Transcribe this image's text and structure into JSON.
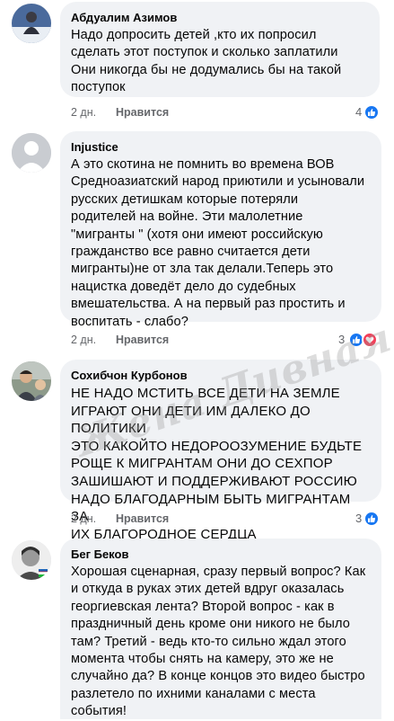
{
  "comments": [
    {
      "author": "Абдуалим Азимов",
      "text": "Надо допросить детей ,кто их попросил\nсделать этот поступок и сколько заплатили\nОни никогда бы не додумались бы на такой\nпоступок",
      "time": "2 дн.",
      "like_label": "Нравится",
      "reaction_count": "4",
      "reactions": [
        "like"
      ]
    },
    {
      "author": "Injustice",
      "text": "А это скотина не помнить во времена ВОВ\nСредноазиатский народ приютили и усыновали\nрусских детишкам   которые потеряли\nродителей на войне. Эти малолетние\n\"мигранты \" (хотя они имеют российскую\nгражданство  все равно считается дети\nмигранты)не от зла  так делали.Теперь это\nнацистка доведёт дело до судебных\nвмешательства. А на первый раз простить и\nвоспитать - слабо?",
      "time": "2 дн.",
      "like_label": "Нравится",
      "reaction_count": "3",
      "reactions": [
        "like",
        "love"
      ]
    },
    {
      "author": "Сохибчон Курбонов",
      "text": "НЕ НАДО МСТИТЬ ВСЕ ДЕТИ  НА ЗЕМЛЕ\nИГРАЮТ ОНИ ДЕТИ ИМ ДАЛЕКО ДО ПОЛИТИКИ\nЭТО КАКОЙТО  НЕДОРООЗУМЕНИЕ БУДЬТЕ\nРОЩЕ К МИГРАНТАМ ОНИ ДО СЕХПОР\nЗАШИШАЮТ И ПОДДЕРЖИВАЮТ РОССИЮ\nНАДО БЛАГОДАРНЫМ БЫТЬ МИГРАНТАМ ЗА\nИХ БЛАГОРОДНОЕ СЕРДЦА",
      "time": "2 дн.",
      "like_label": "Нравится",
      "reaction_count": "3",
      "reactions": [
        "like"
      ]
    },
    {
      "author": "Бег Беков",
      "text": "Хорошая сценарная, сразу первый вопрос? Как\nи откуда в руках этих детей вдруг оказалась\nгеоргиевская лента? Второй вопрос - как в\nпраздничный день кроме они никого не было\nтам? Третий - ведь кто-то сильно ждал этого\nмомента чтобы снять на камеру, это же не\nслучайно да? В конце концов это видео быстро\nразлетело по ихними каналами с места\nсобытия!"
    }
  ],
  "watermark": "Жена Дивная",
  "colors": {
    "bubble": "#f0f2f5",
    "meta": "#65676b",
    "like_reaction": "#1877f2",
    "love_reaction": "#f33e58"
  }
}
